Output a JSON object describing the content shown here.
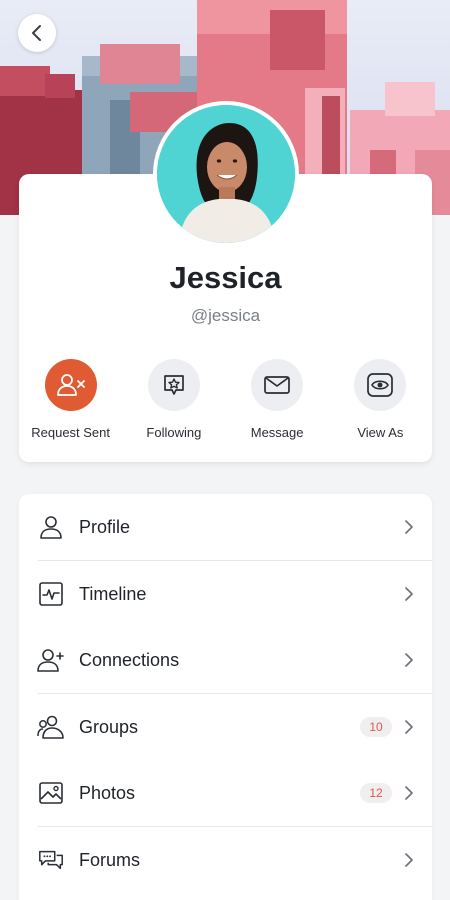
{
  "profile": {
    "name": "Jessica",
    "handle": "@jessica"
  },
  "actions": [
    {
      "label": "Request Sent",
      "icon": "user-x-icon"
    },
    {
      "label": "Following",
      "icon": "star-bubble-icon"
    },
    {
      "label": "Message",
      "icon": "envelope-icon"
    },
    {
      "label": "View As",
      "icon": "eye-icon"
    }
  ],
  "menu": [
    {
      "label": "Profile",
      "icon": "user-icon"
    },
    {
      "label": "Timeline",
      "icon": "activity-icon"
    },
    {
      "label": "Connections",
      "icon": "user-plus-icon"
    },
    {
      "label": "Groups",
      "icon": "users-icon",
      "badge": "10"
    },
    {
      "label": "Photos",
      "icon": "image-icon",
      "badge": "12"
    },
    {
      "label": "Forums",
      "icon": "chat-icon"
    }
  ],
  "colors": {
    "accent": "#e05b33",
    "badge_text": "#d85a4a"
  }
}
